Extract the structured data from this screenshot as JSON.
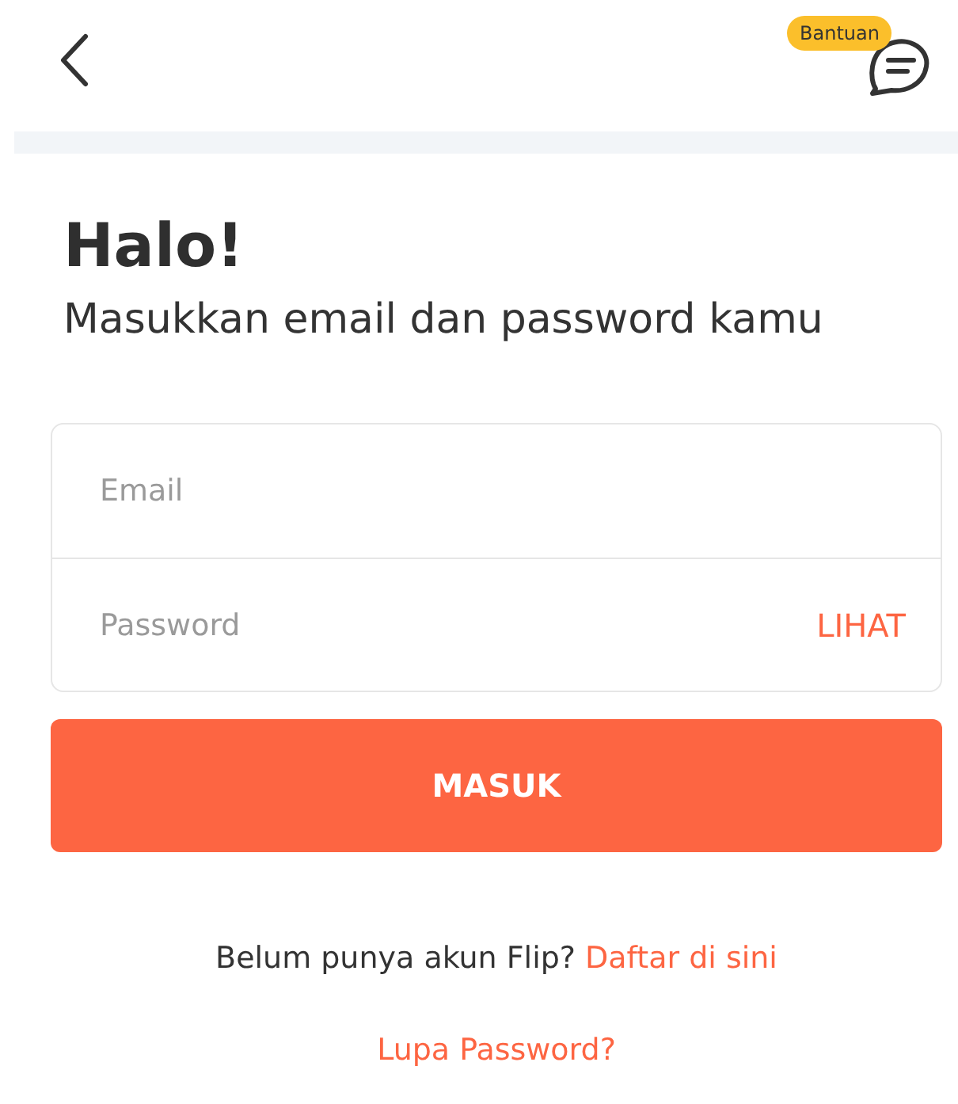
{
  "header": {
    "help_badge": "Bantuan"
  },
  "title": "Halo!",
  "subtitle": "Masukkan email dan password kamu",
  "form": {
    "email": {
      "placeholder": "Email"
    },
    "password": {
      "placeholder": "Password",
      "toggle": "LIHAT"
    }
  },
  "submit_button": "MASUK",
  "signup": {
    "prompt": "Belum punya akun Flip?",
    "link": "Daftar di sini"
  },
  "forgot_link": "Lupa Password?"
}
